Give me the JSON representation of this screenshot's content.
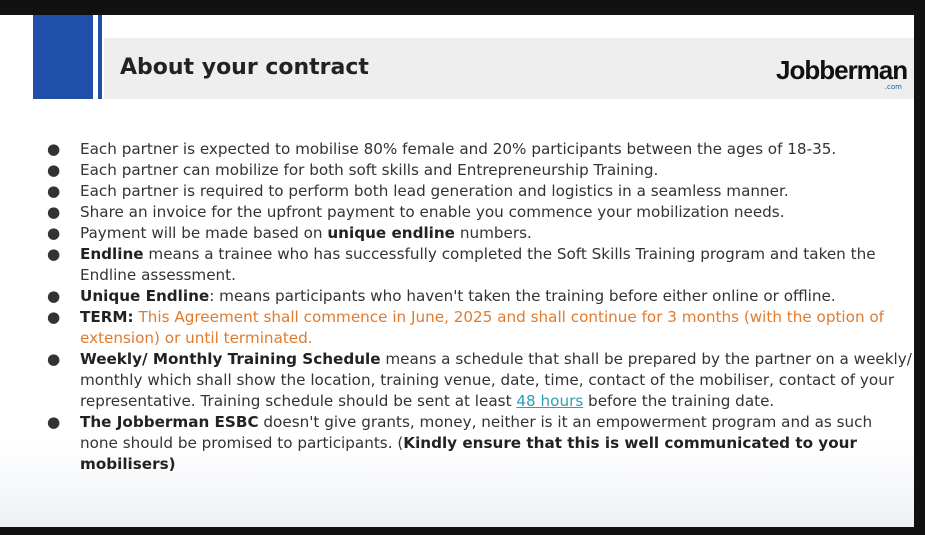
{
  "slide": {
    "title": "About your contract",
    "logo_text": "Jobberman",
    "logo_sub": ".com"
  },
  "bullets": [
    {
      "text": "Each partner is expected to mobilise 80% female and 20% participants between the ages of 18-35."
    },
    {
      "text": "Each partner can mobilize for both soft skills and Entrepreneurship Training."
    },
    {
      "text": "Each partner is required to perform both lead generation and logistics in a seamless manner."
    },
    {
      "text": "Share an invoice for the upfront payment to enable you commence your mobilization needs."
    },
    {
      "pre": "Payment will be made based on ",
      "bold": "unique endline",
      "post": " numbers."
    },
    {
      "bold": "Endline",
      "post": " means a trainee who has successfully completed the Soft Skills Training program and taken the Endline assessment."
    },
    {
      "bold": "Unique Endline",
      "post": ": means participants who haven't taken the training before either online or offline."
    },
    {
      "bold": "TERM:",
      "post": "  This Agreement shall commence in June, 2025 and shall continue for 3 months (with the option of extension) or until terminated."
    },
    {
      "bold": "Weekly/ Monthly Training Schedule",
      "post": " means a schedule that shall be prepared by the partner on a weekly/ monthly which shall show the location, training venue, date, time, contact of the mobiliser, contact of your representative. Training schedule should be sent at least ",
      "link": "48 hours",
      "post2": " before the training date."
    },
    {
      "bold": "The Jobberman ESBC",
      "post": " doesn't give grants, money, neither is it an empowerment program and as such none should be promised to participants. (",
      "bold2": "Kindly ensure that this is well communicated to your mobilisers)"
    }
  ],
  "bullet_symbol": "●",
  "colors": {
    "accent_blue": "#1f4fa8",
    "orange": "#e07b2e",
    "link": "#2c9fb5"
  }
}
